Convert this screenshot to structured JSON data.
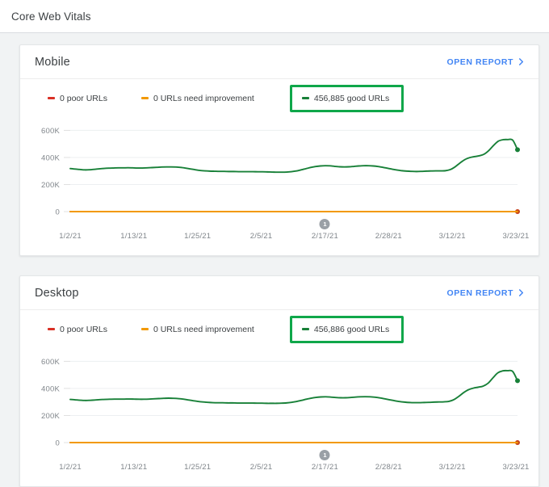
{
  "appbar": {
    "title": "Core Web Vitals"
  },
  "colors": {
    "poor": "#d93025",
    "poor_line": "#c5431b",
    "need_improvement": "#f29900",
    "good": "#188038",
    "good_highlight_border": "#0fa74a",
    "link": "#4285f4",
    "annotation": "#9aa0a6"
  },
  "cards": [
    {
      "title": "Mobile",
      "open_report_label": "OPEN REPORT",
      "open_report_icon": "chevron-right-icon",
      "legend": [
        {
          "label": "0 poor URLs",
          "color": "#d93025",
          "highlighted": false
        },
        {
          "label": "0 URLs need improvement",
          "color": "#f29900",
          "highlighted": false
        },
        {
          "label": "456,885 good URLs",
          "color": "#188038",
          "highlighted": true
        }
      ],
      "chart_data": {
        "type": "line",
        "title": "Mobile",
        "xlabel": "",
        "ylabel": "",
        "ylim": [
          0,
          680000
        ],
        "yticks": [
          "0",
          "200K",
          "400K",
          "600K"
        ],
        "ytick_values": [
          0,
          200000,
          400000,
          600000
        ],
        "grid": true,
        "legend_position": "top",
        "annotations": [
          {
            "id": "1",
            "x_label": "2/17/21"
          }
        ],
        "x": [
          "1/2/21",
          "1/13/21",
          "1/25/21",
          "2/5/21",
          "2/17/21",
          "2/28/21",
          "3/12/21",
          "3/23/21"
        ],
        "xticks": [
          "1/2/21",
          "1/13/21",
          "1/25/21",
          "2/5/21",
          "2/17/21",
          "2/28/21",
          "3/12/21",
          "3/23/21"
        ],
        "series": [
          {
            "name": "0 poor URLs",
            "color": "#c5431b",
            "end_marker": true,
            "values": [
              0,
              0,
              0,
              0,
              0,
              0,
              0,
              0,
              0,
              0,
              0,
              0,
              0,
              0,
              0,
              0,
              0,
              0,
              0,
              0,
              0,
              0,
              0,
              0,
              0,
              0,
              0,
              0,
              0,
              0,
              0,
              0,
              0,
              0,
              0,
              0,
              0,
              0,
              0,
              0,
              0,
              0,
              0,
              0,
              0,
              0,
              0,
              0,
              0,
              0,
              0,
              0,
              0,
              0,
              0,
              0,
              0,
              0,
              0,
              0,
              0,
              0,
              0,
              0,
              0,
              0,
              0,
              0,
              0,
              0,
              0,
              0,
              0,
              0,
              0,
              0,
              0,
              0,
              0,
              0,
              0,
              0,
              0,
              0,
              0,
              0,
              0,
              0,
              0
            ]
          },
          {
            "name": "0 URLs need improvement",
            "color": "#f29900",
            "end_marker": false,
            "values": [
              0,
              0,
              0,
              0,
              0,
              0,
              0,
              0,
              0,
              0,
              0,
              0,
              0,
              0,
              0,
              0,
              0,
              0,
              0,
              0,
              0,
              0,
              0,
              0,
              0,
              0,
              0,
              0,
              0,
              0,
              0,
              0,
              0,
              0,
              0,
              0,
              0,
              0,
              0,
              0,
              0,
              0,
              0,
              0,
              0,
              0,
              0,
              0,
              0,
              0,
              0,
              0,
              0,
              0,
              0,
              0,
              0,
              0,
              0,
              0,
              0,
              0,
              0,
              0,
              0,
              0,
              0,
              0,
              0,
              0,
              0,
              0,
              0,
              0,
              0,
              0,
              0,
              0,
              0,
              0,
              0,
              0,
              0,
              0,
              0,
              0,
              0,
              0,
              0
            ]
          },
          {
            "name": "456,885 good URLs",
            "color": "#188038",
            "end_marker": true,
            "values": [
              318000,
              314000,
              311000,
              308000,
              309000,
              312000,
              316000,
              319000,
              321000,
              322000,
              323000,
              323000,
              324000,
              323000,
              322000,
              322000,
              323000,
              325000,
              327000,
              329000,
              330000,
              330000,
              329000,
              326000,
              321000,
              315000,
              309000,
              304000,
              301000,
              299000,
              298000,
              297000,
              297000,
              296000,
              296000,
              295000,
              295000,
              295000,
              295000,
              294000,
              294000,
              293000,
              292000,
              291000,
              291000,
              292000,
              295000,
              300000,
              308000,
              317000,
              326000,
              333000,
              337000,
              339000,
              338000,
              334000,
              331000,
              330000,
              331000,
              334000,
              337000,
              339000,
              339000,
              337000,
              333000,
              327000,
              320000,
              313000,
              307000,
              302000,
              299000,
              297000,
              296000,
              297000,
              299000,
              300000,
              301000,
              301000,
              302000,
              310000,
              330000,
              358000,
              383000,
              398000,
              406000,
              412000,
              423000,
              450000,
              488000,
              520000,
              531000,
              532000,
              528000,
              456885
            ]
          }
        ]
      }
    },
    {
      "title": "Desktop",
      "open_report_label": "OPEN REPORT",
      "open_report_icon": "chevron-right-icon",
      "legend": [
        {
          "label": "0 poor URLs",
          "color": "#d93025",
          "highlighted": false
        },
        {
          "label": "0 URLs need improvement",
          "color": "#f29900",
          "highlighted": false
        },
        {
          "label": "456,886 good URLs",
          "color": "#188038",
          "highlighted": true
        }
      ],
      "chart_data": {
        "type": "line",
        "title": "Desktop",
        "xlabel": "",
        "ylabel": "",
        "ylim": [
          0,
          680000
        ],
        "yticks": [
          "0",
          "200K",
          "400K",
          "600K"
        ],
        "ytick_values": [
          0,
          200000,
          400000,
          600000
        ],
        "grid": true,
        "legend_position": "top",
        "annotations": [
          {
            "id": "1",
            "x_label": "2/17/21"
          }
        ],
        "x": [
          "1/2/21",
          "1/13/21",
          "1/25/21",
          "2/5/21",
          "2/17/21",
          "2/28/21",
          "3/12/21",
          "3/23/21"
        ],
        "xticks": [
          "1/2/21",
          "1/13/21",
          "1/25/21",
          "2/5/21",
          "2/17/21",
          "2/28/21",
          "3/12/21",
          "3/23/21"
        ],
        "series": [
          {
            "name": "0 poor URLs",
            "color": "#c5431b",
            "end_marker": true,
            "values": [
              0,
              0,
              0,
              0,
              0,
              0,
              0,
              0,
              0,
              0,
              0,
              0,
              0,
              0,
              0,
              0,
              0,
              0,
              0,
              0,
              0,
              0,
              0,
              0,
              0,
              0,
              0,
              0,
              0,
              0,
              0,
              0,
              0,
              0,
              0,
              0,
              0,
              0,
              0,
              0,
              0,
              0,
              0,
              0,
              0,
              0,
              0,
              0,
              0,
              0,
              0,
              0,
              0,
              0,
              0,
              0,
              0,
              0,
              0,
              0,
              0,
              0,
              0,
              0,
              0,
              0,
              0,
              0,
              0,
              0,
              0,
              0,
              0,
              0,
              0,
              0,
              0,
              0,
              0,
              0,
              0,
              0,
              0,
              0,
              0,
              0,
              0,
              0,
              0
            ]
          },
          {
            "name": "0 URLs need improvement",
            "color": "#f29900",
            "end_marker": false,
            "values": [
              0,
              0,
              0,
              0,
              0,
              0,
              0,
              0,
              0,
              0,
              0,
              0,
              0,
              0,
              0,
              0,
              0,
              0,
              0,
              0,
              0,
              0,
              0,
              0,
              0,
              0,
              0,
              0,
              0,
              0,
              0,
              0,
              0,
              0,
              0,
              0,
              0,
              0,
              0,
              0,
              0,
              0,
              0,
              0,
              0,
              0,
              0,
              0,
              0,
              0,
              0,
              0,
              0,
              0,
              0,
              0,
              0,
              0,
              0,
              0,
              0,
              0,
              0,
              0,
              0,
              0,
              0,
              0,
              0,
              0,
              0,
              0,
              0,
              0,
              0,
              0,
              0,
              0,
              0,
              0,
              0,
              0,
              0,
              0,
              0,
              0,
              0,
              0,
              0
            ]
          },
          {
            "name": "456,886 good URLs",
            "color": "#188038",
            "end_marker": true,
            "values": [
              319000,
              316000,
              313000,
              311000,
              312000,
              314000,
              317000,
              319000,
              320000,
              321000,
              321000,
              321000,
              322000,
              321000,
              320000,
              320000,
              321000,
              323000,
              325000,
              327000,
              328000,
              327000,
              325000,
              321000,
              315000,
              309000,
              304000,
              300000,
              297000,
              295000,
              294000,
              294000,
              293000,
              293000,
              292000,
              292000,
              292000,
              292000,
              291000,
              291000,
              290000,
              290000,
              290000,
              291000,
              293000,
              297000,
              303000,
              311000,
              320000,
              328000,
              334000,
              337000,
              338000,
              336000,
              333000,
              331000,
              331000,
              333000,
              336000,
              338000,
              339000,
              338000,
              335000,
              330000,
              323000,
              316000,
              309000,
              303000,
              299000,
              296000,
              295000,
              295000,
              296000,
              297000,
              299000,
              300000,
              301000,
              304000,
              316000,
              340000,
              368000,
              390000,
              402000,
              409000,
              417000,
              438000,
              478000,
              515000,
              530000,
              531000,
              526000,
              456886
            ]
          }
        ]
      }
    }
  ]
}
